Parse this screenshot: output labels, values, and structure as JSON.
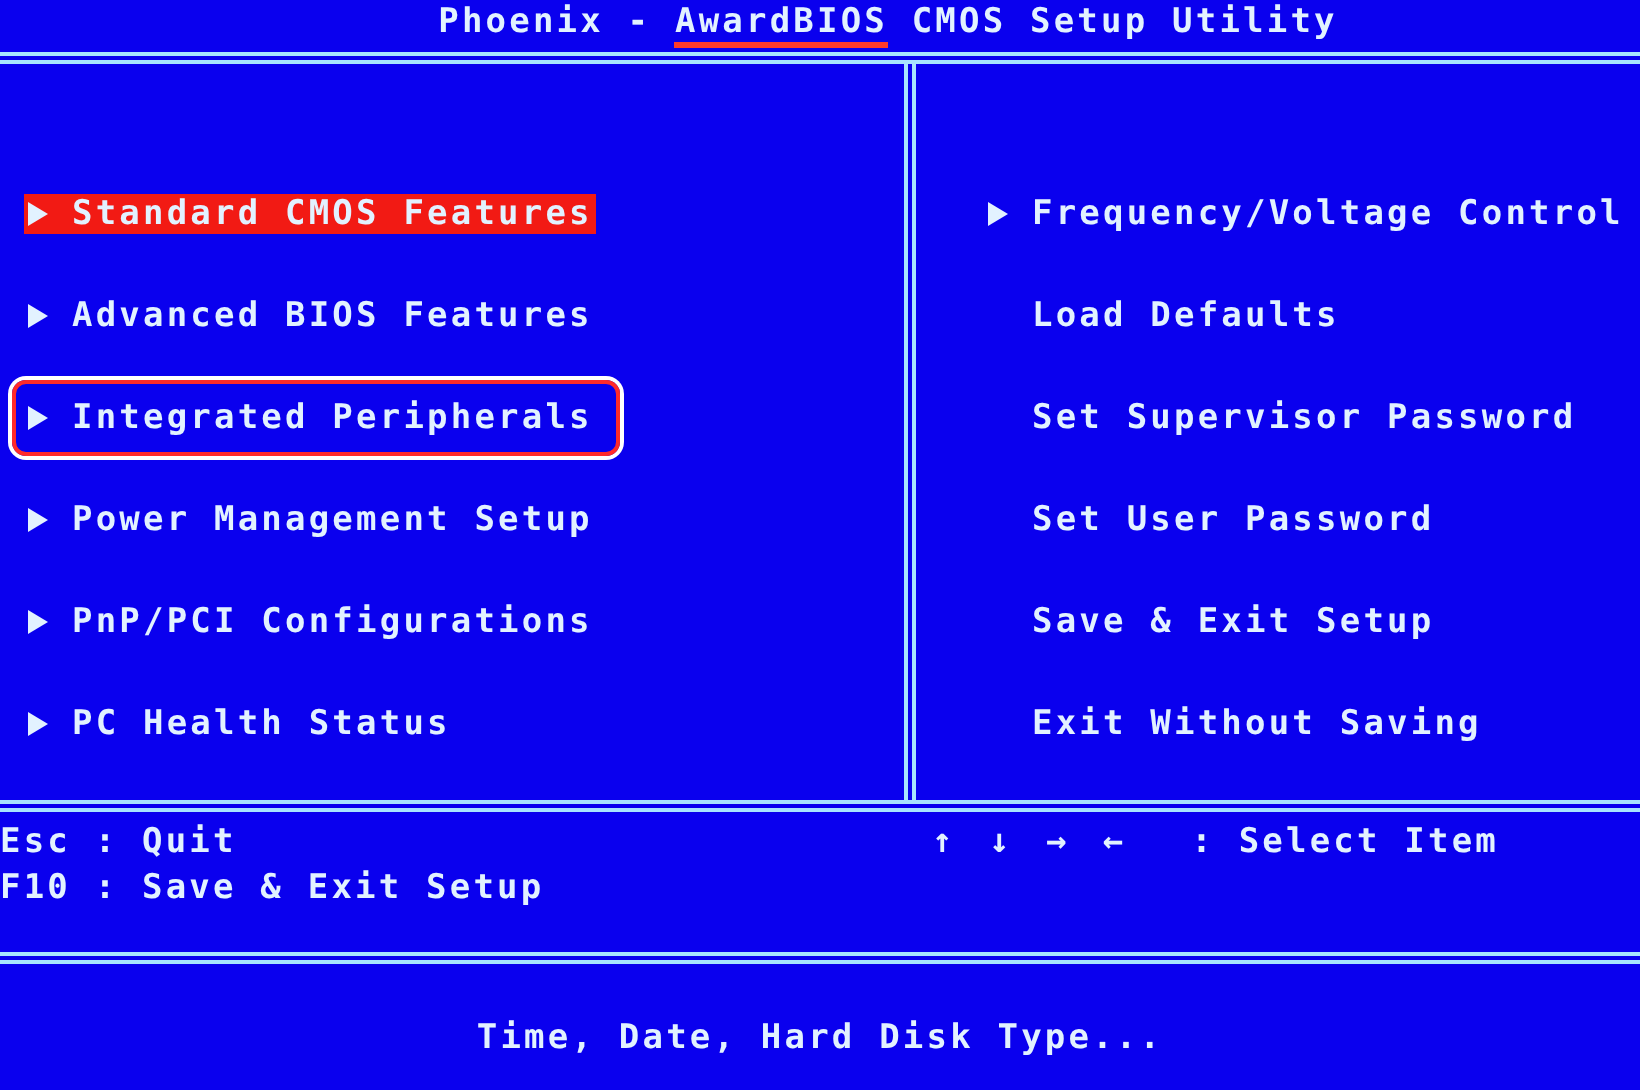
{
  "window": {
    "title_parts": [
      {
        "text": "Phoenix - ",
        "annotated": false
      },
      {
        "text": "AwardBIOS",
        "annotated": true
      },
      {
        "text": " CMOS Setup Utility",
        "annotated": false
      }
    ]
  },
  "menu": {
    "left": [
      {
        "label": "Standard CMOS Features",
        "submenu": true,
        "selected": true,
        "annotated": false
      },
      {
        "label": "Advanced BIOS Features",
        "submenu": true,
        "selected": false,
        "annotated": false
      },
      {
        "label": "Integrated Peripherals",
        "submenu": true,
        "selected": false,
        "annotated": true
      },
      {
        "label": "Power Management Setup",
        "submenu": true,
        "selected": false,
        "annotated": false
      },
      {
        "label": "PnP/PCI Configurations",
        "submenu": true,
        "selected": false,
        "annotated": false
      },
      {
        "label": "PC Health Status",
        "submenu": true,
        "selected": false,
        "annotated": false
      }
    ],
    "right": [
      {
        "label": "Frequency/Voltage Control",
        "submenu": true,
        "selected": false,
        "annotated": false
      },
      {
        "label": "Load Defaults",
        "submenu": false,
        "selected": false,
        "annotated": false
      },
      {
        "label": "Set Supervisor Password",
        "submenu": false,
        "selected": false,
        "annotated": false
      },
      {
        "label": "Set User Password",
        "submenu": false,
        "selected": false,
        "annotated": false
      },
      {
        "label": "Save & Exit Setup",
        "submenu": false,
        "selected": false,
        "annotated": false
      },
      {
        "label": "Exit Without Saving",
        "submenu": false,
        "selected": false,
        "annotated": false
      }
    ]
  },
  "help": {
    "left": [
      "Esc : Quit",
      "F10 : Save & Exit Setup"
    ],
    "keys": "↑ ↓ → ←",
    "keys_action": ": Select Item"
  },
  "status_bar": "Time, Date, Hard Disk Type..."
}
